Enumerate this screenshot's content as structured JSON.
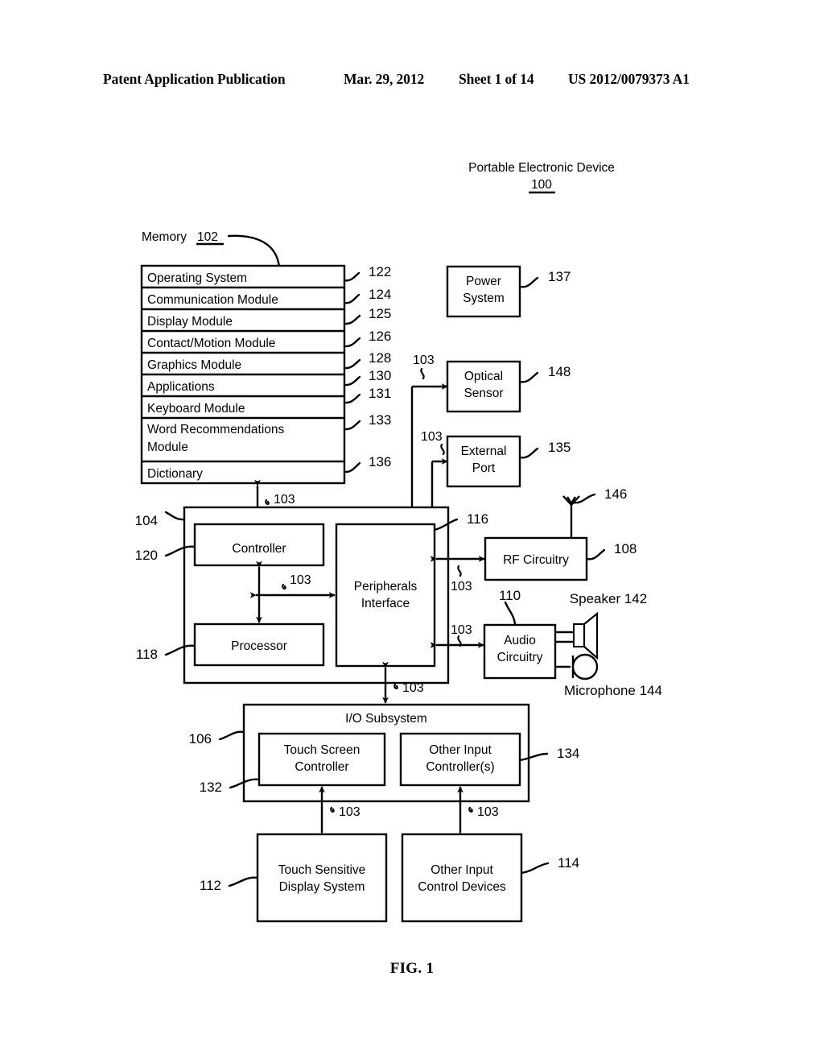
{
  "page": {
    "header": {
      "publication": "Patent Application Publication",
      "date": "Mar. 29, 2012",
      "sheet": "Sheet 1 of 14",
      "patent_number": "US 2012/0079373 A1"
    },
    "figure_caption": "FIG. 1"
  },
  "diagram": {
    "title": "Portable Electronic Device",
    "title_ref": "100",
    "memory": {
      "label": "Memory",
      "ref": "102",
      "rows": [
        {
          "label": "Operating System",
          "ref": "122"
        },
        {
          "label": "Communication Module",
          "ref": "124"
        },
        {
          "label": "Display Module",
          "ref": "125"
        },
        {
          "label": "Contact/Motion Module",
          "ref": "126"
        },
        {
          "label": "Graphics Module",
          "ref": "128"
        },
        {
          "label": "Applications",
          "ref": "130"
        },
        {
          "label": "Keyboard Module",
          "ref": "131"
        },
        {
          "label": "Word Recommendations Module",
          "ref": "133"
        },
        {
          "label": "Dictionary",
          "ref": "136"
        }
      ]
    },
    "blocks": {
      "power_system": {
        "label": "Power System",
        "ref": "137"
      },
      "optical_sensor": {
        "label": "Optical Sensor",
        "ref": "148"
      },
      "external_port": {
        "label": "External Port",
        "ref": "135"
      },
      "controller": {
        "label": "Controller",
        "ref": "120"
      },
      "processor": {
        "label": "Processor",
        "ref": "118"
      },
      "peripherals": {
        "label": "Peripherals Interface",
        "ref": "116"
      },
      "outer_container": {
        "label": "",
        "ref": "104"
      },
      "rf_circuitry": {
        "label": "RF Circuitry",
        "ref": "108"
      },
      "antenna": {
        "label": "",
        "ref": "146"
      },
      "audio_circuitry": {
        "label": "Audio Circuitry",
        "ref": "110"
      },
      "speaker": {
        "label": "Speaker 142"
      },
      "microphone": {
        "label": "Microphone 144"
      },
      "io_subsystem": {
        "label": "I/O Subsystem",
        "ref": "106"
      },
      "touch_screen_ctrl": {
        "label": "Touch Screen Controller",
        "ref": "132"
      },
      "other_input_ctrl": {
        "label": "Other Input Controller(s)",
        "ref": "134"
      },
      "touch_display": {
        "label": "Touch Sensitive Display System",
        "ref": "112"
      },
      "other_input_dev": {
        "label": "Other Input Control Devices",
        "ref": "114"
      }
    },
    "bus_ref": "103",
    "bus_labels": [
      "103",
      "103",
      "103",
      "103",
      "103",
      "103",
      "103",
      "103",
      "103",
      "103"
    ]
  }
}
